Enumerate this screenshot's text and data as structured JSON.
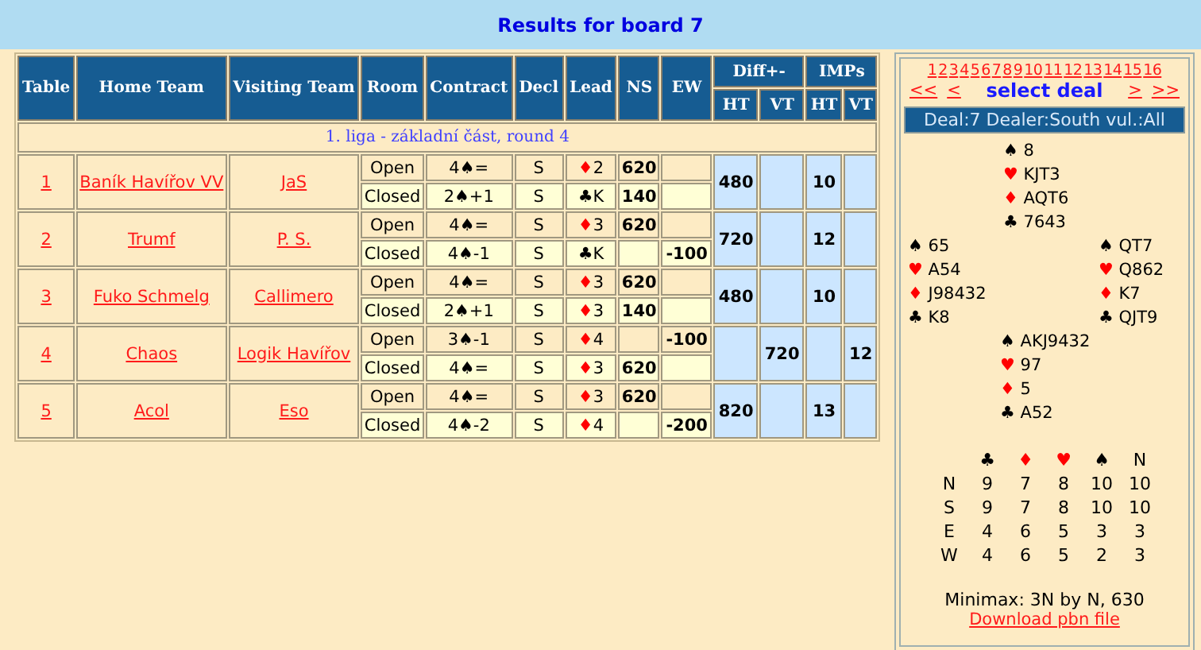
{
  "title": "Results for board 7",
  "columns": {
    "table": "Table",
    "home": "Home Team",
    "visiting": "Visiting Team",
    "room": "Room",
    "contract": "Contract",
    "decl": "Decl",
    "lead": "Lead",
    "ns": "NS",
    "ew": "EW",
    "diff": "Diff+-",
    "imps": "IMPs",
    "sub": [
      "HT",
      "VT",
      "HT",
      "VT"
    ]
  },
  "section": "1. liga - základní část, round 4",
  "matches": [
    {
      "table": "1",
      "home": "Baník Havířov VV",
      "visiting": "JaS",
      "diff_ht": "480",
      "imp_ht": "10",
      "rooms": [
        {
          "room": "Open",
          "contract": "4♠=",
          "decl": "S",
          "lead": {
            "suit": "♦",
            "rank": "2",
            "red": true
          },
          "ns": "620"
        },
        {
          "room": "Closed",
          "contract": "2♠+1",
          "decl": "S",
          "lead": {
            "suit": "♣",
            "rank": "K",
            "red": false
          },
          "ns": "140"
        }
      ]
    },
    {
      "table": "2",
      "home": "Trumf",
      "visiting": "P. S.",
      "diff_ht": "720",
      "imp_ht": "12",
      "rooms": [
        {
          "room": "Open",
          "contract": "4♠=",
          "decl": "S",
          "lead": {
            "suit": "♦",
            "rank": "3",
            "red": true
          },
          "ns": "620"
        },
        {
          "room": "Closed",
          "contract": "4♠-1",
          "decl": "S",
          "lead": {
            "suit": "♣",
            "rank": "K",
            "red": false
          },
          "ew": "-100"
        }
      ]
    },
    {
      "table": "3",
      "home": "Fuko Schmelg",
      "visiting": "Callimero",
      "diff_ht": "480",
      "imp_ht": "10",
      "rooms": [
        {
          "room": "Open",
          "contract": "4♠=",
          "decl": "S",
          "lead": {
            "suit": "♦",
            "rank": "3",
            "red": true
          },
          "ns": "620"
        },
        {
          "room": "Closed",
          "contract": "2♠+1",
          "decl": "S",
          "lead": {
            "suit": "♦",
            "rank": "3",
            "red": true
          },
          "ns": "140"
        }
      ]
    },
    {
      "table": "4",
      "home": "Chaos",
      "visiting": "Logik Havířov",
      "diff_vt": "720",
      "imp_vt": "12",
      "rooms": [
        {
          "room": "Open",
          "contract": "3♠-1",
          "decl": "S",
          "lead": {
            "suit": "♦",
            "rank": "4",
            "red": true
          },
          "ew": "-100"
        },
        {
          "room": "Closed",
          "contract": "4♠=",
          "decl": "S",
          "lead": {
            "suit": "♦",
            "rank": "3",
            "red": true
          },
          "ns": "620"
        }
      ]
    },
    {
      "table": "5",
      "home": "Acol",
      "visiting": "Eso",
      "diff_ht": "820",
      "imp_ht": "13",
      "rooms": [
        {
          "room": "Open",
          "contract": "4♠=",
          "decl": "S",
          "lead": {
            "suit": "♦",
            "rank": "3",
            "red": true
          },
          "ns": "620"
        },
        {
          "room": "Closed",
          "contract": "4♠-2",
          "decl": "S",
          "lead": {
            "suit": "♦",
            "rank": "4",
            "red": true
          },
          "ew": "-200"
        }
      ]
    }
  ],
  "panel": {
    "deals": [
      "1",
      "2",
      "3",
      "4",
      "5",
      "6",
      "7",
      "8",
      "9",
      "10",
      "11",
      "12",
      "13",
      "14",
      "15",
      "16"
    ],
    "nav_prev": [
      "<<",
      "<"
    ],
    "select": "select deal",
    "nav_next": [
      ">",
      ">>"
    ],
    "deal_header": "Deal:7 Dealer:South  vul.:All",
    "north": [
      {
        "suit": "♠",
        "cards": "8",
        "red": false
      },
      {
        "suit": "♥",
        "cards": "KJT3",
        "red": true
      },
      {
        "suit": "♦",
        "cards": "AQT6",
        "red": true
      },
      {
        "suit": "♣",
        "cards": "7643",
        "red": false
      }
    ],
    "west": [
      {
        "suit": "♠",
        "cards": "65",
        "red": false
      },
      {
        "suit": "♥",
        "cards": "A54",
        "red": true
      },
      {
        "suit": "♦",
        "cards": "J98432",
        "red": true
      },
      {
        "suit": "♣",
        "cards": "K8",
        "red": false
      }
    ],
    "east": [
      {
        "suit": "♠",
        "cards": "QT7",
        "red": false
      },
      {
        "suit": "♥",
        "cards": "Q862",
        "red": true
      },
      {
        "suit": "♦",
        "cards": "K7",
        "red": true
      },
      {
        "suit": "♣",
        "cards": "QJT9",
        "red": false
      }
    ],
    "south": [
      {
        "suit": "♠",
        "cards": "AKJ9432",
        "red": false
      },
      {
        "suit": "♥",
        "cards": "97",
        "red": true
      },
      {
        "suit": "♦",
        "cards": "5",
        "red": true
      },
      {
        "suit": "♣",
        "cards": "A52",
        "red": false
      }
    ],
    "dd_header": [
      {
        "label": "♣",
        "red": false
      },
      {
        "label": "♦",
        "red": true
      },
      {
        "label": "♥",
        "red": true
      },
      {
        "label": "♠",
        "red": false
      },
      {
        "label": "N",
        "red": false
      }
    ],
    "dd_rows": [
      [
        "N",
        "9",
        "7",
        "8",
        "10",
        "10"
      ],
      [
        "S",
        "9",
        "7",
        "8",
        "10",
        "10"
      ],
      [
        "E",
        "4",
        "6",
        "5",
        "3",
        "3"
      ],
      [
        "W",
        "4",
        "6",
        "5",
        "2",
        "3"
      ]
    ],
    "minimax": "Minimax: 3N by N, 630",
    "download": "Download pbn file"
  }
}
